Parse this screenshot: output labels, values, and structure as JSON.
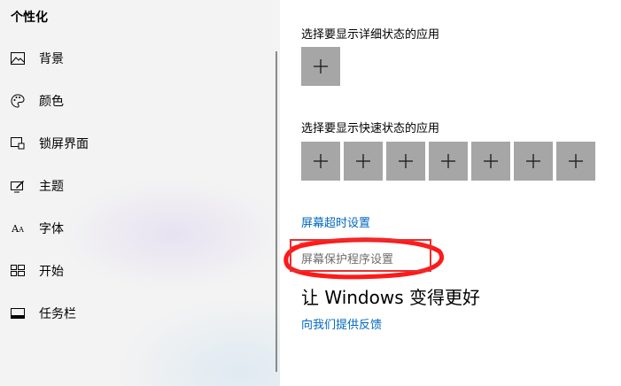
{
  "sidebar": {
    "title": "个性化",
    "items": [
      {
        "label": "背景",
        "icon": "image-icon"
      },
      {
        "label": "颜色",
        "icon": "palette-icon"
      },
      {
        "label": "锁屏界面",
        "icon": "lock-screen-icon"
      },
      {
        "label": "主题",
        "icon": "theme-icon"
      },
      {
        "label": "字体",
        "icon": "font-icon"
      },
      {
        "label": "开始",
        "icon": "start-icon"
      },
      {
        "label": "任务栏",
        "icon": "taskbar-icon"
      }
    ]
  },
  "main": {
    "detailed_status_label": "选择要显示详细状态的应用",
    "quick_status_label": "选择要显示快速状态的应用",
    "quick_status_slot_count": 7,
    "links": {
      "screen_timeout": "屏幕超时设置",
      "screen_saver": "屏幕保护程序设置",
      "feedback": "向我们提供反馈"
    },
    "improve_heading": "让 Windows 变得更好"
  },
  "colors": {
    "accent_link": "#0067c0",
    "tile": "#a6a6a6",
    "annotation": "#e43030"
  }
}
